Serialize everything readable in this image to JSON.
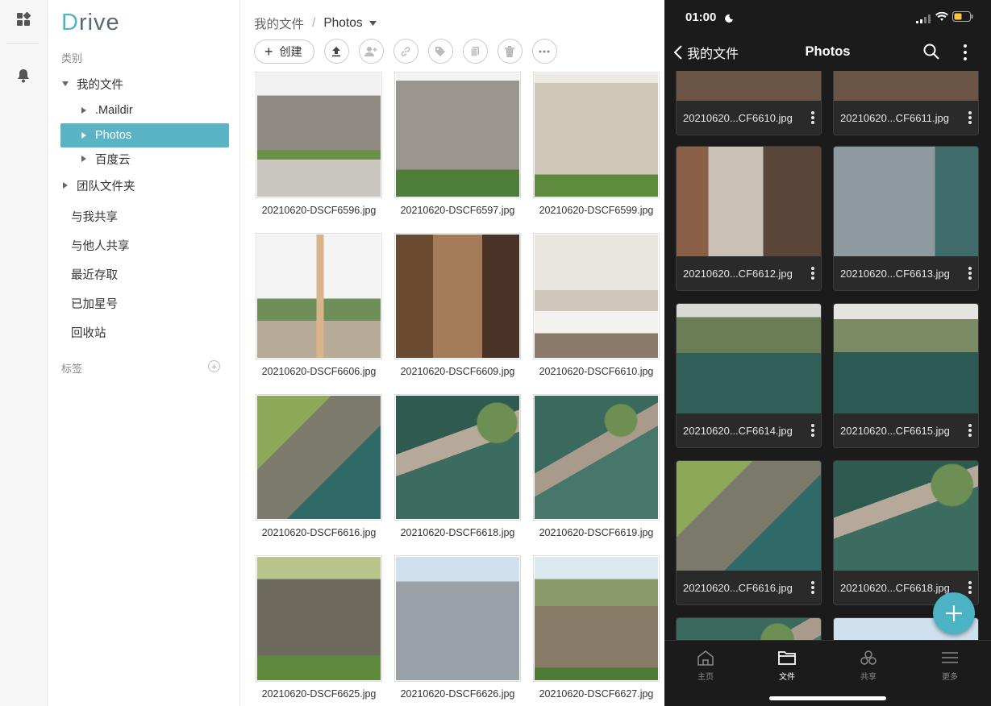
{
  "app": {
    "logo_first": "D",
    "logo_rest": "rive"
  },
  "sidebar": {
    "category_label": "类别",
    "tree": [
      {
        "label": "我的文件",
        "expanded": true
      },
      {
        "label": ".Maildir"
      },
      {
        "label": "Photos",
        "selected": true
      },
      {
        "label": "百度云"
      },
      {
        "label": "团队文件夹"
      }
    ],
    "nav": [
      "与我共享",
      "与他人共享",
      "最近存取",
      "已加星号",
      "回收站"
    ],
    "tags_label": "标签",
    "add_tag": "+"
  },
  "breadcrumb": {
    "root": "我的文件",
    "separator": "/",
    "current": "Photos"
  },
  "toolbar": {
    "create_label": "创建"
  },
  "files": [
    {
      "name": "20210620-DSCF6596.jpg",
      "thumb": "p-wall1"
    },
    {
      "name": "20210620-DSCF6597.jpg",
      "thumb": "p-wall2"
    },
    {
      "name": "20210620-DSCF6599.jpg",
      "thumb": "p-wall3"
    },
    {
      "name": "20210620-DSCF6606.jpg",
      "thumb": "p-needle"
    },
    {
      "name": "20210620-DSCF6609.jpg",
      "thumb": "p-bath"
    },
    {
      "name": "20210620-DSCF6610.jpg",
      "thumb": "p-room"
    },
    {
      "name": "20210620-DSCF6616.jpg",
      "thumb": "p-cliff"
    },
    {
      "name": "20210620-DSCF6618.jpg",
      "thumb": "p-hotel"
    },
    {
      "name": "20210620-DSCF6619.jpg",
      "thumb": "p-hotel2"
    },
    {
      "name": "20210620-DSCF6625.jpg",
      "thumb": "p-cliff2"
    },
    {
      "name": "20210620-DSCF6626.jpg",
      "thumb": "p-tower"
    },
    {
      "name": "20210620-DSCF6627.jpg",
      "thumb": "p-cliff3"
    }
  ],
  "mobile": {
    "time": "01:00",
    "back_label": "我的文件",
    "title": "Photos",
    "files": [
      {
        "name": "20210620...CF6610.jpg",
        "thumb": "p-bed-top"
      },
      {
        "name": "20210620...CF6611.jpg",
        "thumb": "p-bed-top"
      },
      {
        "name": "20210620...CF6612.jpg",
        "thumb": "p-hotel-room"
      },
      {
        "name": "20210620...CF6613.jpg",
        "thumb": "p-facade"
      },
      {
        "name": "20210620...CF6614.jpg",
        "thumb": "p-quarry1"
      },
      {
        "name": "20210620...CF6615.jpg",
        "thumb": "p-quarry2"
      },
      {
        "name": "20210620...CF6616.jpg",
        "thumb": "p-cliff"
      },
      {
        "name": "20210620...CF6618.jpg",
        "thumb": "p-hotel"
      },
      {
        "name": "",
        "thumb": "p-hotel2"
      },
      {
        "name": "",
        "thumb": "p-tower"
      }
    ],
    "tabs": [
      {
        "label": "主页",
        "icon": "home-icon"
      },
      {
        "label": "文件",
        "icon": "folder-icon",
        "active": true
      },
      {
        "label": "共享",
        "icon": "share-icon"
      },
      {
        "label": "更多",
        "icon": "menu-icon"
      }
    ]
  },
  "colors": {
    "accent": "#5ab4c5",
    "fab": "#4bb3c4",
    "phone_bg": "#1b1b1b"
  }
}
